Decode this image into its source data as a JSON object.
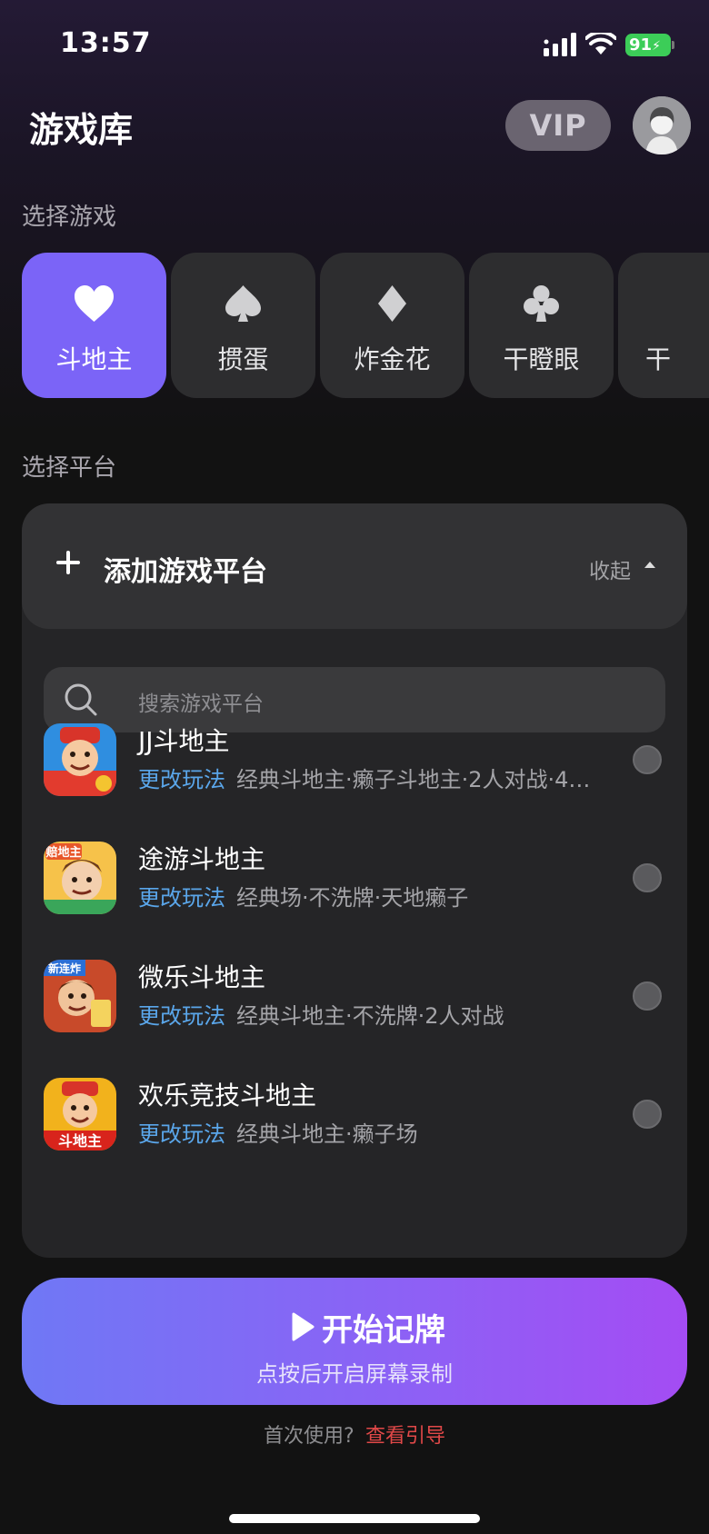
{
  "status": {
    "time": "13:57",
    "battery": "91"
  },
  "header": {
    "title": "游戏库",
    "vip": "VIP"
  },
  "sections": {
    "select_game": "选择游戏",
    "select_platform": "选择平台"
  },
  "games": [
    {
      "label": "斗地主",
      "icon": "heart-icon",
      "selected": true
    },
    {
      "label": "掼蛋",
      "icon": "spade-icon",
      "selected": false
    },
    {
      "label": "炸金花",
      "icon": "diamond-icon",
      "selected": false
    },
    {
      "label": "干瞪眼",
      "icon": "club-icon",
      "selected": false
    },
    {
      "label": "干",
      "icon": "card-icon",
      "selected": false
    }
  ],
  "platform_panel": {
    "title": "添加游戏平台",
    "collapse": "收起",
    "search_placeholder": "搜索游戏平台",
    "items": [
      {
        "name": "JJ斗地主",
        "change": "更改玩法",
        "modes": "经典斗地主·癞子斗地主·2人对战·4…"
      },
      {
        "name": "途游斗地主",
        "change": "更改玩法",
        "modes": "经典场·不洗牌·天地癞子"
      },
      {
        "name": "微乐斗地主",
        "change": "更改玩法",
        "modes": "经典斗地主·不洗牌·2人对战"
      },
      {
        "name": "欢乐竞技斗地主",
        "change": "更改玩法",
        "modes": "经典斗地主·癞子场"
      }
    ],
    "logo_labels": [
      "",
      "赔地主",
      "新连炸",
      "斗地主"
    ]
  },
  "start_button": {
    "label": "开始记牌",
    "sub": "点按后开启屏幕录制"
  },
  "footer": {
    "first_use": "首次使用?",
    "guide": "查看引导"
  },
  "colors": {
    "accent": "#7b64f7",
    "link": "#5aa6ea",
    "guide": "#e04848"
  }
}
